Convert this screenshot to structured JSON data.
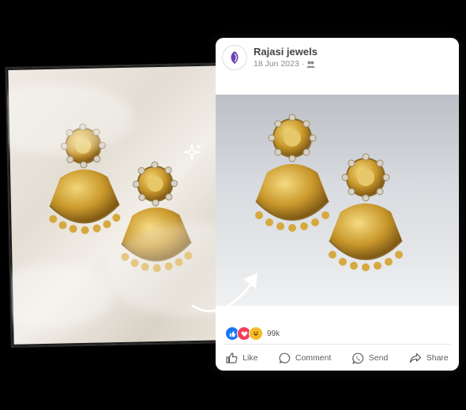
{
  "post": {
    "page_name": "Rajasi jewels",
    "date": "18 Jun 2023",
    "date_separator": "·",
    "audience_icon": "people-icon",
    "reaction_count": "99k",
    "actions": {
      "like": "Like",
      "comment": "Comment",
      "send": "Send",
      "share": "Share"
    }
  },
  "colors": {
    "like_blue": "#1877f2",
    "love_red": "#f33e58",
    "haha_yellow": "#f7b928",
    "gold": "#c9982b"
  }
}
